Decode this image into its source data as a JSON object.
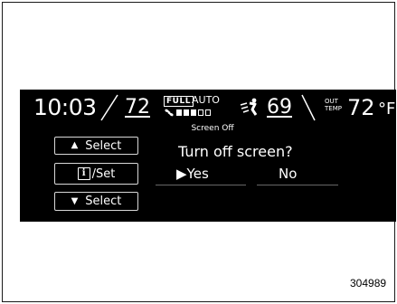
{
  "status_bar": {
    "time": "10:03",
    "driver_temp": "72",
    "fan_mode_badge": "FULL",
    "fan_auto_label": "AUTO",
    "fan_level_bars": [
      true,
      true,
      true,
      false,
      false
    ],
    "passenger_temp": "69",
    "outside_temp_label_line1": "OUT",
    "outside_temp_label_line2": "TEMP",
    "outside_temp_value": "72",
    "outside_temp_unit": "°F"
  },
  "dialog": {
    "header": "Screen Off",
    "prompt": "Turn off screen?",
    "choice_yes": "Yes",
    "choice_yes_marker": "▶",
    "choice_no": "No"
  },
  "buttons": {
    "select_up": {
      "label": "Select",
      "glyph": "▲"
    },
    "set": {
      "label": "/Set",
      "glyph": "i"
    },
    "select_down": {
      "label": "Select",
      "glyph": "▼"
    }
  },
  "figure_reference": "304989",
  "colors": {
    "screen_bg": "#000000",
    "text": "#ffffff",
    "page_bg": "#ffffff"
  }
}
